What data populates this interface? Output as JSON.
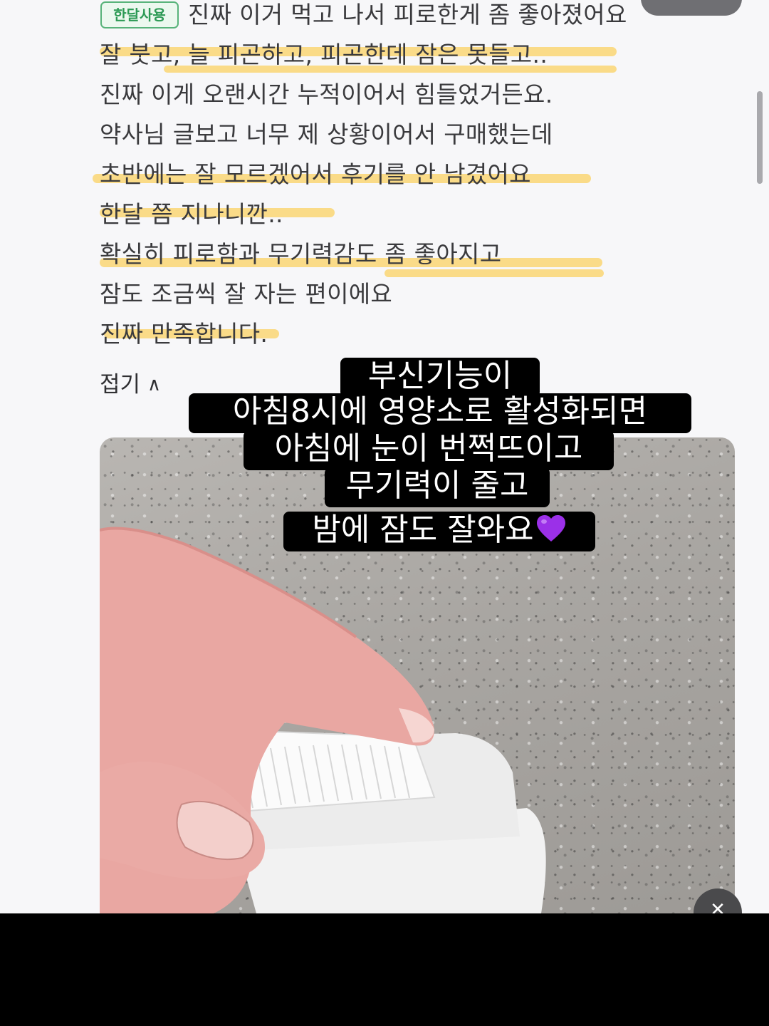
{
  "review": {
    "badge": "한달사용",
    "first_line": "진짜 이거 먹고 나서 피로한게 좀 좋아졌어요",
    "lines": [
      "잘 붓고, 늘 피곤하고, 피곤한데 잠은 못들고..",
      "진짜 이게 오랜시간 누적이어서 힘들었거든요.",
      "약사님 글보고 너무 제 상황이어서 구매했는데",
      "초반에는 잘 모르겠어서 후기를 안 남겼어요",
      "한달 쯤 지나니깐..",
      "확실히 피로함과 무기력감도 좀 좋아지고",
      "잠도 조금씩 잘 자는 편이에요",
      "진짜 만족합니다."
    ],
    "fold_label": "접기",
    "fold_icon": "chevron-up-icon",
    "highlight_color": "#fbd05c"
  },
  "caption": {
    "lines": [
      "부신기능이",
      "아침8시에 영양소로 활성화되면",
      "아침에 눈이 번쩍뜨이고",
      "무기력이 줄고",
      "밤에 잠도 잘와요"
    ],
    "emoji": "purple-heart-icon"
  }
}
